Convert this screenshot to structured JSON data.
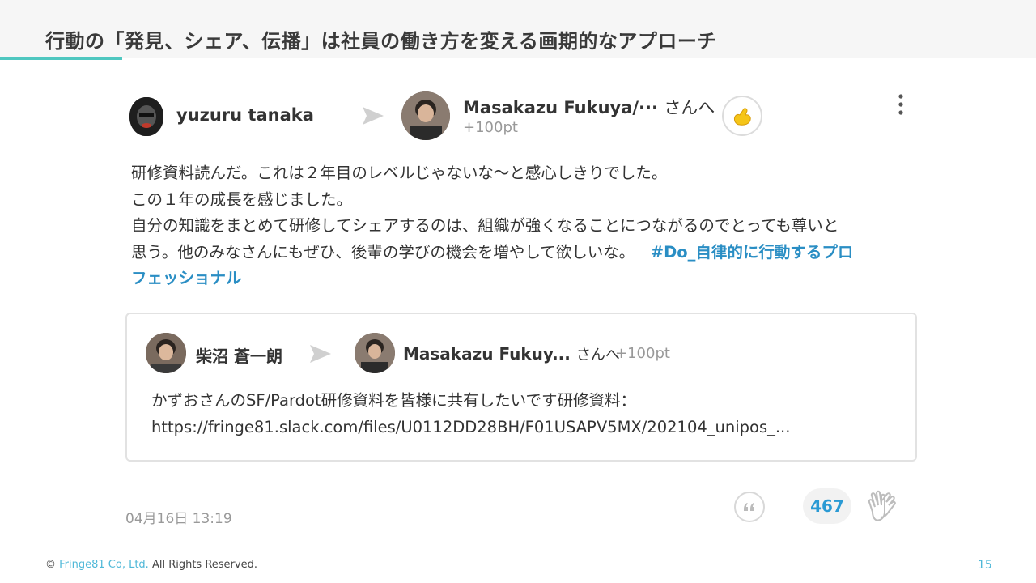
{
  "slide": {
    "title": "行動の「発見、シェア、伝播」は社員の働き方を変える画期的なアプローチ",
    "page_number": "15",
    "copyright_symbol": "©",
    "copyright_brand": "Fringe81 Co, Ltd.",
    "copyright_text": "All Rights Reserved."
  },
  "post": {
    "sender": "yuzuru tanaka",
    "receiver_name": "Masakazu Fukuya/···",
    "receiver_suffix": "さんへ",
    "points": "+100pt",
    "message_lines": [
      "研修資料読んだ。これは２年目のレベルじゃないな〜と感心しきりでした。",
      "この１年の成長を感じました。",
      "自分の知識をまとめて研修してシェアするのは、組織が強くなることにつながるのでとっても尊いと",
      "思う。他のみなさんにもぜひ、後輩の学びの機会を増やして欲しいな。"
    ],
    "hashtag_part1": "#Do_自律的に行動するプロ",
    "hashtag_part2": "フェッショナル",
    "timestamp": "04月16日 13:19",
    "clap_count": "467",
    "icons": {
      "more": "more-vertical-icon",
      "reaction": "flexed-biceps-icon",
      "quote": "quote-icon",
      "clap": "clapping-hands-icon",
      "arrow": "send-arrow-icon"
    }
  },
  "quoted_post": {
    "sender": "柴沼 蒼一朗",
    "receiver_name": "Masakazu Fukuy...",
    "receiver_suffix": "さんへ",
    "points": "+100pt",
    "body_line1": "かずおさんのSF/Pardot研修資料を皆様に共有したいです研修資料：",
    "body_line2": "https://fringe81.slack.com/files/U0112DD28BH/F01USAPV5MX/202104_unipos_..."
  },
  "colors": {
    "accent_teal": "#4fc7c0",
    "hashtag_blue": "#2a8ec4",
    "count_blue": "#2a9ad4",
    "muted_gray": "#999999"
  }
}
